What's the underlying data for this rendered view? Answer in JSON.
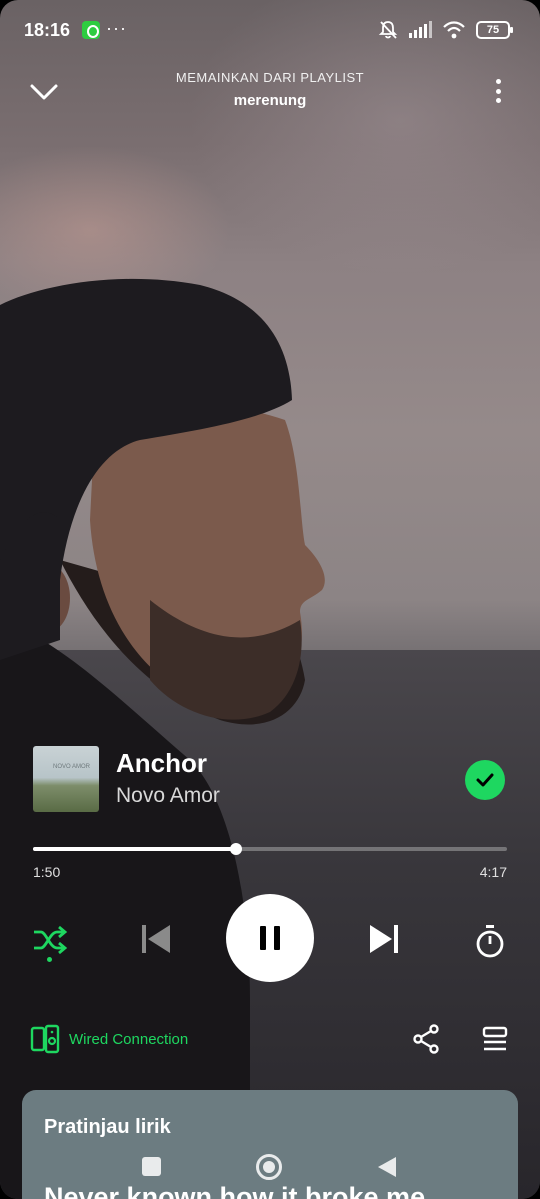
{
  "status_bar": {
    "time": "18:16",
    "overflow": "···",
    "battery": "75",
    "icons": [
      "notification-app-icon",
      "bell-muted-icon",
      "signal-icon",
      "wifi-icon",
      "battery-icon"
    ]
  },
  "header": {
    "subtitle": "MEMAINKAN DARI PLAYLIST",
    "playlist": "merenung",
    "icons": [
      "chevron-down-icon",
      "more-vertical-icon"
    ]
  },
  "track": {
    "title": "Anchor",
    "artist": "Novo Amor",
    "cover_caption": "NOVO AMOR",
    "saved": true
  },
  "progress": {
    "elapsed": "1:50",
    "total": "4:17",
    "fraction": 0.428
  },
  "controls": {
    "shuffle_active": true,
    "state": "playing",
    "icons": [
      "shuffle-icon",
      "skip-previous-icon",
      "pause-icon",
      "skip-next-icon",
      "sleep-timer-icon"
    ]
  },
  "bottom_bar": {
    "device_label": "Wired Connection",
    "icons": [
      "device-speaker-icon",
      "share-icon",
      "queue-icon"
    ]
  },
  "lyrics": {
    "title": "Pratinjau lirik",
    "first_line": "Never known how it broke me"
  },
  "colors": {
    "accent": "#1ed760",
    "lyrics_card": "#6c7c81"
  }
}
